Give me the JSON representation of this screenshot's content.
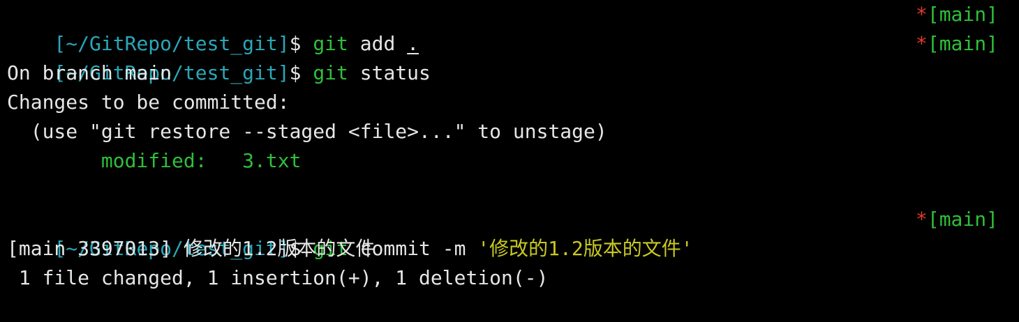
{
  "prompt": {
    "path": "[~/GitRepo/test_git]",
    "dollar": "$",
    "right_star": "*",
    "right_branch": "[main]"
  },
  "commands": {
    "c1_cmd": "git",
    "c1_rest": " add ",
    "c1_dot": ".",
    "c2_cmd": "git",
    "c2_rest": " status",
    "c3_cmd": "git",
    "c3_rest": " commit -m ",
    "c3_msg": "'修改的1.2版本的文件'"
  },
  "output": {
    "line1": "On branch main",
    "line2": "Changes to be committed:",
    "line3": "  (use \"git restore --staged <file>...\" to unstage)",
    "line4_indent": "        ",
    "line4": "modified:   3.txt",
    "line5": "[main 3397013] 修改的1.2版本的文件",
    "line6": " 1 file changed, 1 insertion(+), 1 deletion(-)"
  },
  "colors": {
    "background": "#000000",
    "prompt": "#2aa7b8",
    "command": "#2fbf3a",
    "message": "#c9c922",
    "star": "#e03a2e"
  }
}
